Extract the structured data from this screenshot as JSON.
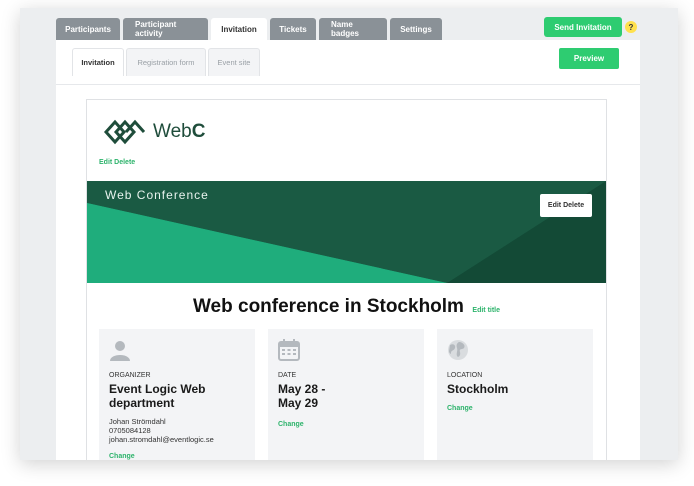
{
  "top_tabs": [
    "Participants",
    "Participant activity",
    "Invitation",
    "Tickets",
    "Name badges",
    "Settings"
  ],
  "send_button": "Send Invitation",
  "help_icon": "?",
  "sub_tabs": [
    "Invitation",
    "Registration form",
    "Event site"
  ],
  "preview_button": "Preview",
  "logo": {
    "text_regular": "Web",
    "text_bold": "C",
    "icon": "webc-logo-icon",
    "color": "#1f4d3b"
  },
  "logo_actions": "Edit Delete",
  "banner": {
    "title": "Web Conference",
    "actions": "Edit Delete",
    "dark": "#1a5a43",
    "light": "#1fad7c"
  },
  "main_title": "Web conference in Stockholm",
  "edit_title": "Edit title",
  "accent_color": "#2ecc71",
  "cards": [
    {
      "icon": "user-icon",
      "label": "ORGANIZER",
      "value": "Event Logic Web department",
      "details": [
        "Johan Strömdahl",
        "0705084128",
        "johan.stromdahl@eventlogic.se"
      ],
      "action": "Change"
    },
    {
      "icon": "calendar-icon",
      "label": "DATE",
      "value": "May 28 - May 29",
      "action": "Change"
    },
    {
      "icon": "globe-icon",
      "label": "LOCATION",
      "value": "Stockholm",
      "action": "Change"
    }
  ]
}
